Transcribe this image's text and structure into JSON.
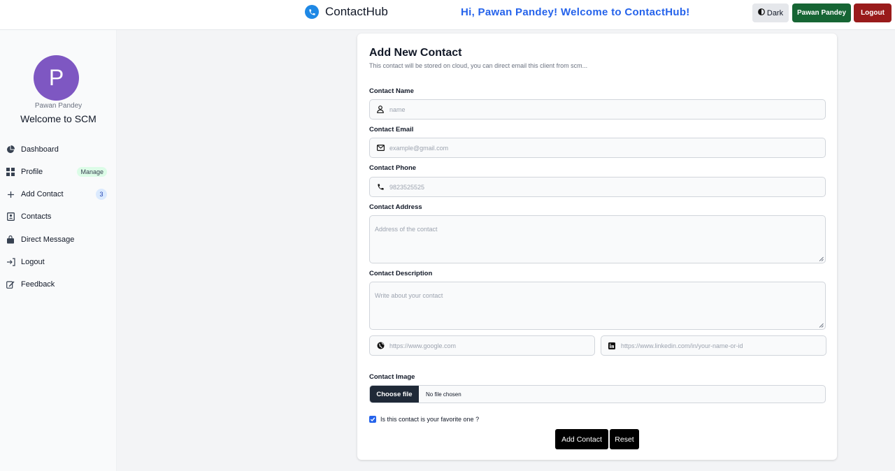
{
  "navbar": {
    "brand": "ContactHub",
    "welcome": "Hi, Pawan Pandey! Welcome to ContactHub!",
    "dark_label": "Dark",
    "user_label": "Pawan Pandey",
    "logout_label": "Logout"
  },
  "sidebar": {
    "avatar_letter": "P",
    "username": "Pawan Pandey",
    "welcome": "Welcome to SCM",
    "items": [
      {
        "label": "Dashboard",
        "icon": "pie-chart-icon"
      },
      {
        "label": "Profile",
        "icon": "grid-icon",
        "badge": "Manage"
      },
      {
        "label": "Add Contact",
        "icon": "plus-icon",
        "badge": "3"
      },
      {
        "label": "Contacts",
        "icon": "address-book-icon"
      },
      {
        "label": "Direct Message",
        "icon": "bag-icon"
      },
      {
        "label": "Logout",
        "icon": "sign-out-icon"
      },
      {
        "label": "Feedback",
        "icon": "edit-icon"
      }
    ]
  },
  "form": {
    "title": "Add New Contact",
    "subtitle": "This contact will be stored on cloud, you can direct email this client from scm...",
    "name_label": "Contact Name",
    "name_placeholder": "name",
    "email_label": "Contact Email",
    "email_placeholder": "example@gmail.com",
    "phone_label": "Contact Phone",
    "phone_placeholder": "9823525525",
    "address_label": "Contact Address",
    "address_placeholder": "Address of the contact",
    "description_label": "Contact Description",
    "description_placeholder": "Write about your contact",
    "website_placeholder": "https://www.google.com",
    "linkedin_placeholder": "https://www.linkedin.com/in/your-name-or-id",
    "image_label": "Contact Image",
    "choose_file": "Choose file",
    "no_file": "No file chosen",
    "favorite_label": "Is this contact is your favorite one ?",
    "favorite_checked": true,
    "submit_label": "Add Contact",
    "reset_label": "Reset"
  },
  "colors": {
    "brand_blue": "#1e88e5",
    "welcome_blue": "#2563eb",
    "user_green": "#166534",
    "logout_red": "#991b1b",
    "avatar_purple": "#7e57c2"
  }
}
